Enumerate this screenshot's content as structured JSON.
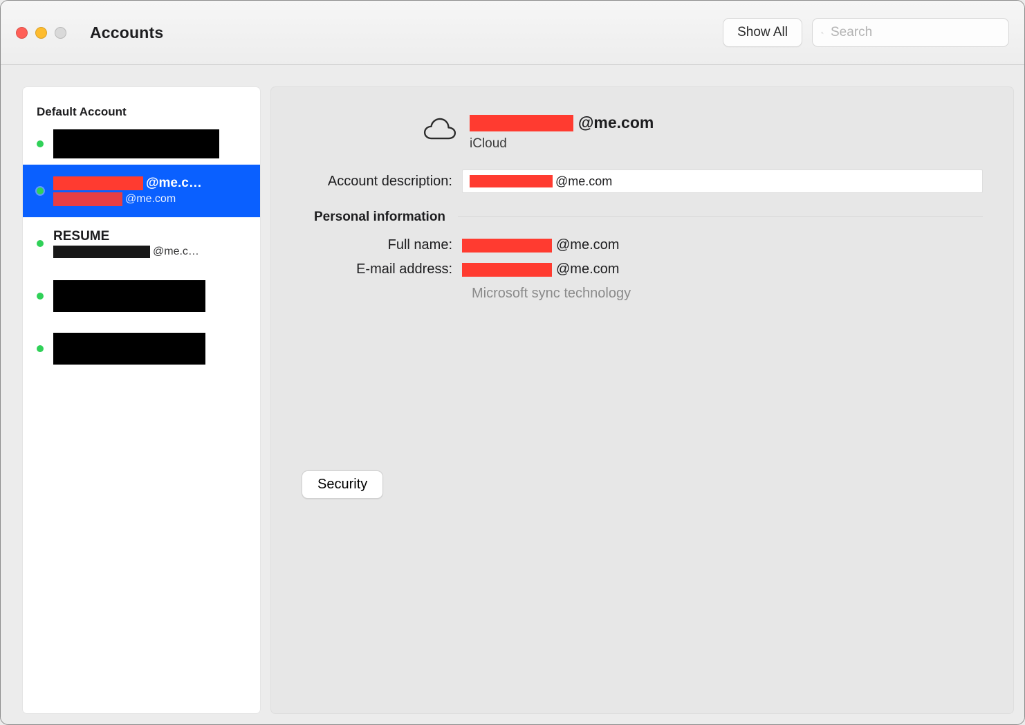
{
  "window": {
    "title": "Accounts"
  },
  "toolbar": {
    "show_all_label": "Show All",
    "search_placeholder": "Search"
  },
  "sidebar": {
    "header": "Default Account",
    "items": [
      {
        "selected": false
      },
      {
        "selected": true,
        "title_suffix": "@me.c…",
        "subtitle_suffix": "@me.com"
      },
      {
        "selected": false,
        "title": "RESUME",
        "subtitle_suffix": "@me.c…"
      },
      {
        "selected": false
      },
      {
        "selected": false
      }
    ]
  },
  "detail": {
    "email_suffix": "@me.com",
    "account_type": "iCloud",
    "description_label": "Account description:",
    "description_value_suffix": "@me.com",
    "personal_info_heading": "Personal information",
    "full_name_label": "Full name:",
    "full_name_value_suffix": "@me.com",
    "email_label": "E-mail address:",
    "email_value_suffix": "@me.com",
    "sync_note": "Microsoft sync technology",
    "security_button": "Security"
  }
}
